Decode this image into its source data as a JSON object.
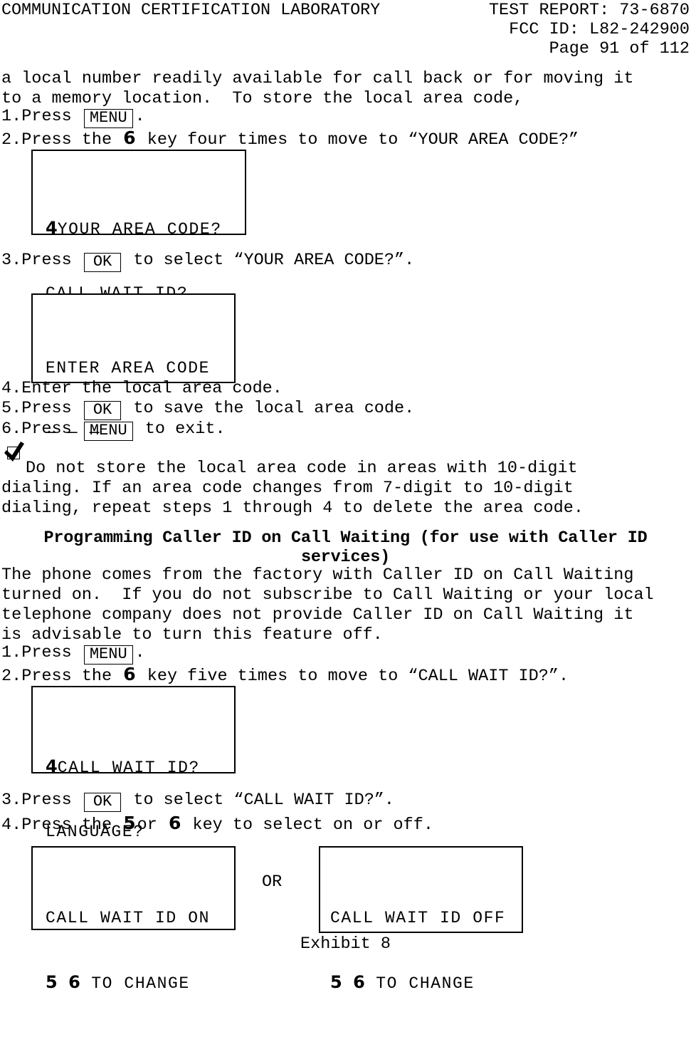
{
  "header": {
    "lab": "COMMUNICATION CERTIFICATION LABORATORY",
    "test_report": "TEST REPORT: 73-6870",
    "fcc_id": "FCC ID: L82-242900",
    "page": "Page 91 of 112"
  },
  "intro": {
    "line1": "a local number readily available for call back or for moving it",
    "line2": "to a memory location.  To store the local area code,"
  },
  "section1": {
    "steps": [
      {
        "num": "1.",
        "pre": "Press ",
        "key": "MENU",
        "post": "."
      },
      {
        "num": "2.",
        "pre": "Press the ",
        "digit": "6",
        "post": " key four times to move to “YOUR AREA CODE?”"
      },
      {
        "num": "3.",
        "pre": "Press ",
        "key": "OK",
        "post": " to select “YOUR AREA CODE?”."
      },
      {
        "num": "4.",
        "pre": "Enter the local area code."
      },
      {
        "num": "5.",
        "pre": "Press ",
        "key": "OK",
        "post": " to save the local area code."
      },
      {
        "num": "6.",
        "pre": "Press ",
        "key": "MENU",
        "post": " to exit."
      }
    ],
    "lcd1": {
      "arrow": "4",
      "line1": "YOUR AREA CODE?",
      "line2": "CALL WAIT ID?"
    },
    "lcd2": {
      "line1": "ENTER AREA CODE",
      "line2": "— — —"
    }
  },
  "note": {
    "icon": "checked-box-icon",
    "line1": "Do not store the local area code in areas with 10-digit",
    "line2": "dialing. If an area code changes from 7-digit to 10-digit",
    "line3": "dialing, repeat steps 1 through 4 to delete the area code."
  },
  "section2": {
    "heading_line1": "Programming Caller ID on Call Waiting (for use with Caller ID",
    "heading_line2": "services)",
    "para": {
      "line1": "The phone comes from the factory with Caller ID on Call Waiting",
      "line2": "turned on.  If you do not subscribe to Call Waiting or your local",
      "line3": "telephone company does not provide Caller ID on Call Waiting it",
      "line4": "is advisable to turn this feature off."
    },
    "steps": [
      {
        "num": "1.",
        "pre": "Press ",
        "key": "MENU",
        "post": "."
      },
      {
        "num": "2.",
        "pre": "Press the ",
        "digit": "6",
        "post": " key five times to move to “CALL WAIT ID?”."
      },
      {
        "num": "3.",
        "pre": "Press ",
        "key": "OK",
        "post": " to select “CALL WAIT ID?”."
      },
      {
        "num": "4.",
        "pre": "Press the ",
        "digit": "5",
        "mid": "or ",
        "digit2": "6",
        "post": " key to select on or off."
      }
    ],
    "lcd3": {
      "arrow": "4",
      "line1": "CALL WAIT ID?",
      "line2": "LANGUAGE?"
    },
    "lcd_on": {
      "line1": "CALL WAIT ID ON",
      "d1": "5",
      "d2": "6",
      "line2_text": "TO CHANGE"
    },
    "lcd_off": {
      "line1": "CALL WAIT ID OFF",
      "d1": "5",
      "d2": "6",
      "line2_text": "TO CHANGE"
    },
    "or_label": "OR"
  },
  "footer": {
    "exhibit": "Exhibit 8"
  }
}
